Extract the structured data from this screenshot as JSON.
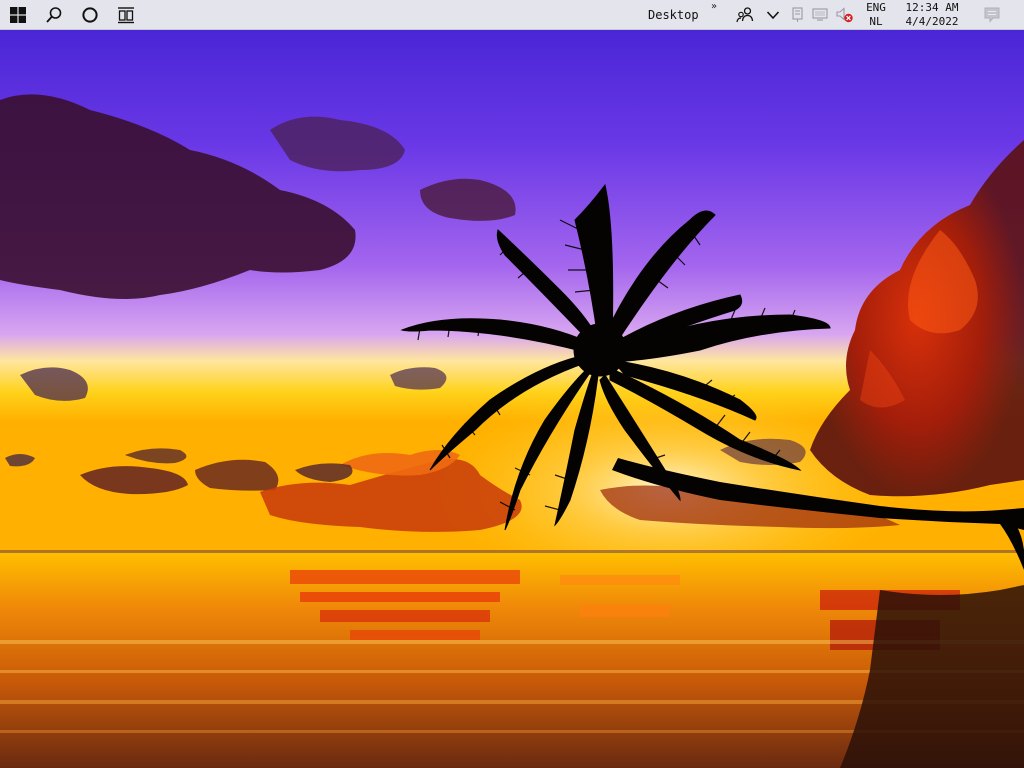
{
  "taskbar": {
    "start": {
      "icon": "windows-logo-icon"
    },
    "search": {
      "icon": "search-icon"
    },
    "cortana": {
      "icon": "cortana-circle-icon"
    },
    "task_view": {
      "icon": "task-view-icon"
    },
    "desktop_toolbar": {
      "label": "Desktop",
      "chevron": "»"
    },
    "people": {
      "icon": "people-icon"
    },
    "overflow": {
      "icon": "chevron-down-icon"
    },
    "tray_icons": [
      "network-icon",
      "display-icon",
      "volume-muted-icon"
    ],
    "language": {
      "line1": "ENG",
      "line2": "NL"
    },
    "clock": {
      "time": "12:34 AM",
      "date": "4/4/2022"
    },
    "notifications": {
      "icon": "action-center-icon"
    }
  },
  "desktop": {
    "wallpaper": "tropical-sunset-palm",
    "colors": {
      "sky_top": "#5a2fe0",
      "sky_mid": "#9a5fe8",
      "horizon": "#ffd21a",
      "sea": "#e07a10",
      "taskbar": "#e4e4ec"
    }
  }
}
